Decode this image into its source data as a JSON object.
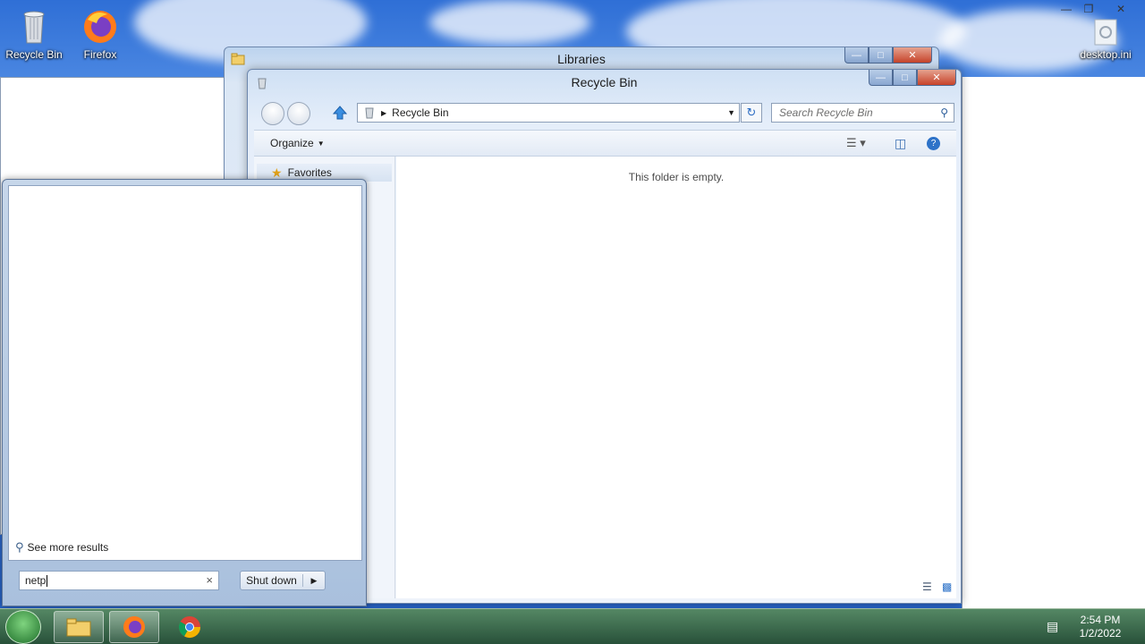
{
  "desktop": {
    "icons": [
      {
        "label": "Recycle Bin",
        "icon": "recycle-bin-icon"
      },
      {
        "label": "Firefox",
        "icon": "firefox-icon"
      },
      {
        "label": "desktop.ini",
        "icon": "file-icon"
      }
    ]
  },
  "libraries_window": {
    "title": "Libraries"
  },
  "recycle_window": {
    "title": "Recycle Bin",
    "breadcrumb": "Recycle Bin",
    "search_placeholder": "Search Recycle Bin",
    "toolbar": {
      "organize_label": "Organize"
    },
    "nav": {
      "favorites_label": "Favorites"
    },
    "empty_message": "This folder is empty."
  },
  "start_menu": {
    "see_more_label": "See more results",
    "search_value": "netp",
    "shutdown_label": "Shut down"
  },
  "taskbar": {
    "apps": [
      {
        "name": "Windows Explorer",
        "icon": "explorer-icon"
      },
      {
        "name": "Firefox",
        "icon": "firefox-icon"
      },
      {
        "name": "Chrome",
        "icon": "chrome-icon"
      }
    ],
    "clock": {
      "time": "2:54 PM",
      "date": "1/2/2022"
    }
  },
  "colors": {
    "accent": "#3b7ad8",
    "taskbar": "#2f5a37"
  }
}
